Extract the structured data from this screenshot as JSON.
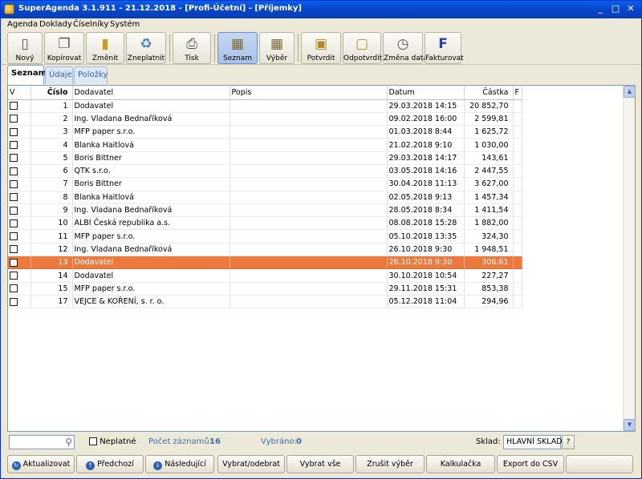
{
  "window": {
    "title": "SuperAgenda 3.1.911 - 21.12.2018 - [Profi-Účetní] - [Příjemky]",
    "controls": [
      "_",
      "□",
      "✕"
    ]
  },
  "menu": [
    "Agenda",
    "Doklady",
    "Číselníky",
    "Systém"
  ],
  "toolbar": [
    {
      "label": "Nový",
      "icon": "new-document-icon"
    },
    {
      "label": "Kopírovat",
      "icon": "copy-icon"
    },
    {
      "label": "Změnit",
      "icon": "edit-binder-icon"
    },
    {
      "label": "Zneplatnit",
      "icon": "trash-icon"
    },
    {
      "label": "Tisk",
      "icon": "printer-icon"
    },
    {
      "label": "Seznam",
      "icon": "list-grid-icon"
    },
    {
      "label": "Výběr",
      "icon": "filter-grid-icon"
    },
    {
      "label": "Potvrdit",
      "icon": "lock-icon"
    },
    {
      "label": "Odpotvrdit",
      "icon": "unlock-icon"
    },
    {
      "label": "Změna data",
      "icon": "stopwatch-icon"
    },
    {
      "label": "Fakturovat",
      "icon": "invoice-f-icon"
    }
  ],
  "tabs": [
    "Seznam",
    "Údaje",
    "Položky"
  ],
  "grid": {
    "columns": [
      "V",
      "Číslo",
      "Dodavatel",
      "Popis",
      "Datum",
      "Částka",
      "F"
    ],
    "rows": [
      {
        "cislo": "1",
        "dodavatel": "Dodavatel",
        "popis": "",
        "datum": "29.03.2018 14:15",
        "castka": "20 852,70"
      },
      {
        "cislo": "2",
        "dodavatel": "Ing. Vladana Bednaříková",
        "popis": "",
        "datum": "09.02.2018 16:00",
        "castka": "2 599,81"
      },
      {
        "cislo": "3",
        "dodavatel": "MFP paper s.r.o.",
        "popis": "",
        "datum": "01.03.2018 8:44",
        "castka": "1 625,72"
      },
      {
        "cislo": "4",
        "dodavatel": "Blanka Haitlová",
        "popis": "",
        "datum": "21.02.2018 9:10",
        "castka": "1 030,00"
      },
      {
        "cislo": "5",
        "dodavatel": "Boris Bittner",
        "popis": "",
        "datum": "29.03.2018 14:17",
        "castka": "143,61"
      },
      {
        "cislo": "6",
        "dodavatel": "QTK s.r.o.",
        "popis": "",
        "datum": "03.05.2018 14:16",
        "castka": "2 447,55"
      },
      {
        "cislo": "7",
        "dodavatel": "Boris Bittner",
        "popis": "",
        "datum": "30.04.2018 11:13",
        "castka": "3 627,00"
      },
      {
        "cislo": "8",
        "dodavatel": "Blanka Haitlová",
        "popis": "",
        "datum": "02.05.2018 9:13",
        "castka": "1 457,34"
      },
      {
        "cislo": "9",
        "dodavatel": "Ing. Vladana Bednaříková",
        "popis": "",
        "datum": "28.05.2018 8:34",
        "castka": "1 411,54"
      },
      {
        "cislo": "10",
        "dodavatel": "ALBI Česká republika a.s.",
        "popis": "",
        "datum": "08.08.2018 15:28",
        "castka": "1 882,00"
      },
      {
        "cislo": "11",
        "dodavatel": "MFP paper s.r.o.",
        "popis": "",
        "datum": "05.10.2018 13:35",
        "castka": "324,30"
      },
      {
        "cislo": "12",
        "dodavatel": "Ing. Vladana Bednaříková",
        "popis": "",
        "datum": "26.10.2018 9:30",
        "castka": "1 948,51"
      },
      {
        "cislo": "13",
        "dodavatel": "Dodavatel",
        "popis": "",
        "datum": "26.10.2018 9:30",
        "castka": "306,61",
        "selected": true
      },
      {
        "cislo": "14",
        "dodavatel": "Dodavatel",
        "popis": "",
        "datum": "30.10.2018 10:54",
        "castka": "227,27"
      },
      {
        "cislo": "15",
        "dodavatel": "MFP paper s.r.o.",
        "popis": "",
        "datum": "29.11.2018 15:31",
        "castka": "853,38"
      },
      {
        "cislo": "17",
        "dodavatel": "VEJCE & KOŘENÍ, s. r. o.",
        "popis": "",
        "datum": "05.12.2018 11:04",
        "castka": "294,96"
      }
    ]
  },
  "status": {
    "search_value": "",
    "neplatne_label": "Neplatné",
    "pocet_label": "Počet záznamů:",
    "pocet_value": "16",
    "vybrano_label": "Vybráno:",
    "vybrano_value": "0",
    "sklad_label": "Sklad:",
    "sklad_value": "HLAVNÍ SKLAD",
    "help_label": "?"
  },
  "bottom_buttons": [
    {
      "label": "Aktualizovat",
      "icon": "refresh-icon"
    },
    {
      "label": "Předchozí",
      "icon": "arrow-up-icon"
    },
    {
      "label": "Následující",
      "icon": "arrow-down-icon"
    },
    {
      "label": "Vybrat/odebrat",
      "icon": ""
    },
    {
      "label": "Vybrat vše",
      "icon": ""
    },
    {
      "label": "Zrušit výběr",
      "icon": ""
    },
    {
      "label": "Kalkulačka",
      "icon": ""
    },
    {
      "label": "Export do CSV",
      "icon": ""
    },
    {
      "label": "",
      "icon": ""
    }
  ],
  "colors": {
    "selection": "#ec7a3f",
    "titlebar": "#0846c9",
    "accent_text": "#3d6fb0"
  }
}
